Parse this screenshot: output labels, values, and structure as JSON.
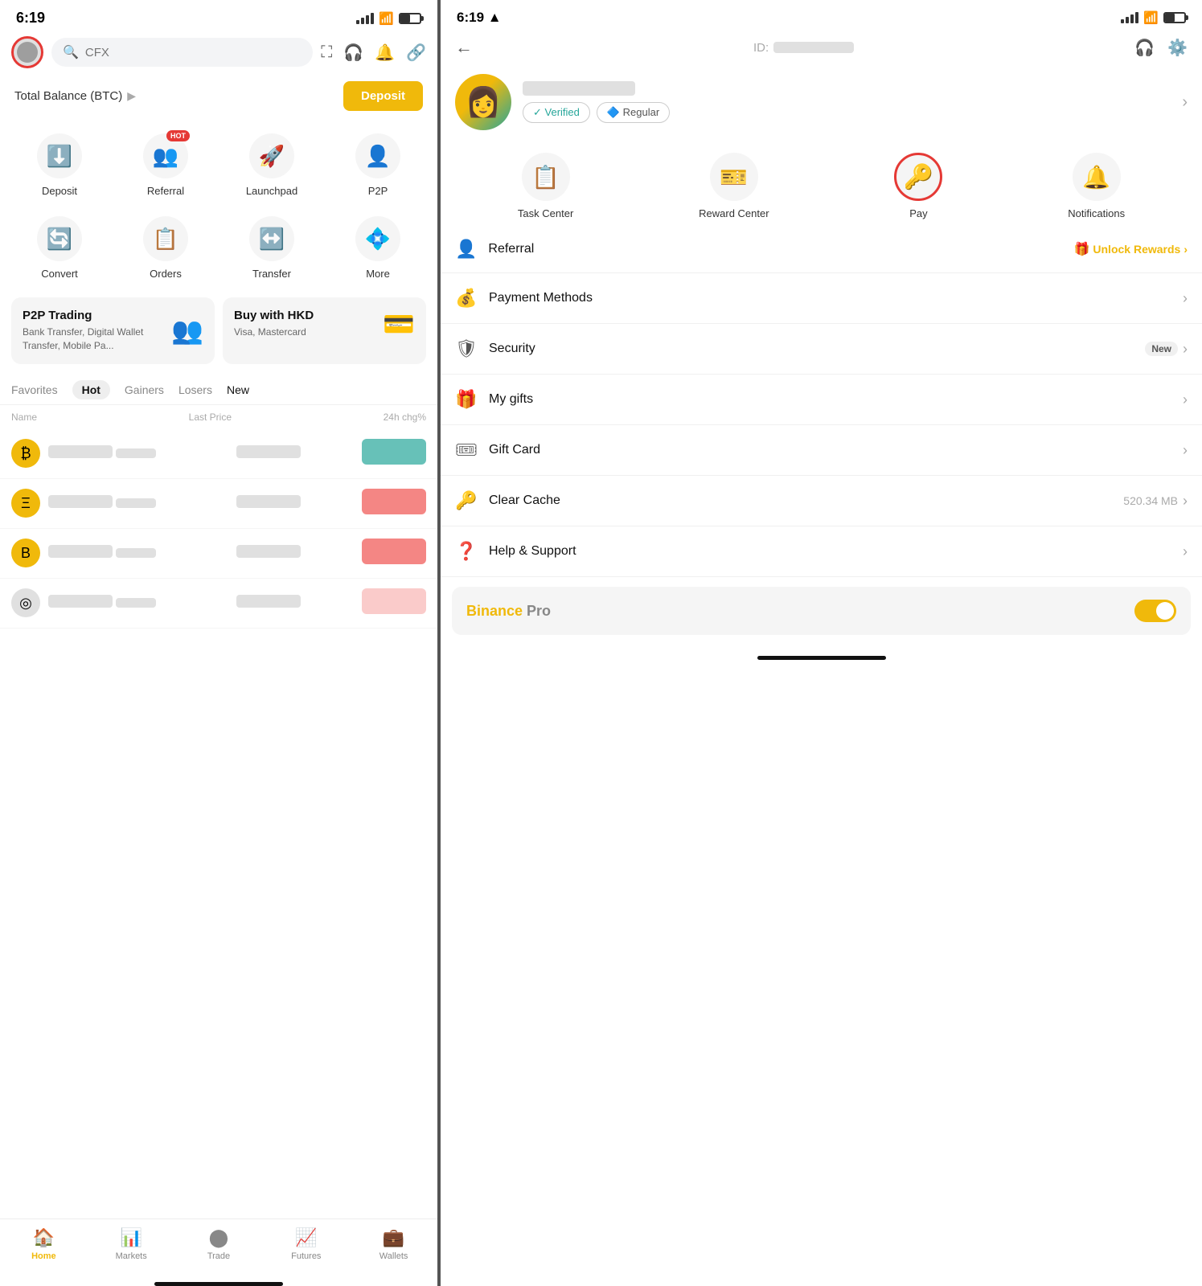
{
  "left": {
    "status": {
      "time": "6:19",
      "battery_level": 50
    },
    "search": {
      "placeholder": "CFX"
    },
    "balance": {
      "label": "Total Balance (BTC)",
      "deposit_btn": "Deposit"
    },
    "actions": [
      {
        "id": "deposit",
        "label": "Deposit",
        "icon": "⬇️",
        "hot": false
      },
      {
        "id": "referral",
        "label": "Referral",
        "icon": "👥",
        "hot": true
      },
      {
        "id": "launchpad",
        "label": "Launchpad",
        "icon": "🚀",
        "hot": false
      },
      {
        "id": "p2p",
        "label": "P2P",
        "icon": "👤",
        "hot": false
      },
      {
        "id": "convert",
        "label": "Convert",
        "icon": "🔄",
        "hot": false
      },
      {
        "id": "orders",
        "label": "Orders",
        "icon": "📋",
        "hot": false
      },
      {
        "id": "transfer",
        "label": "Transfer",
        "icon": "↔️",
        "hot": false
      },
      {
        "id": "more",
        "label": "More",
        "icon": "💠",
        "hot": false
      }
    ],
    "promo": [
      {
        "title": "P2P Trading",
        "sub": "Bank Transfer, Digital Wallet Transfer, Mobile Pa...",
        "icon": "👥"
      },
      {
        "title": "Buy with HKD",
        "sub": "Visa, Mastercard",
        "icon": "💳"
      }
    ],
    "market_tabs": [
      {
        "label": "Favorites",
        "active": false
      },
      {
        "label": "Hot",
        "active": true
      },
      {
        "label": "Gainers",
        "active": false
      },
      {
        "label": "Losers",
        "active": false
      },
      {
        "label": "New",
        "active": false
      }
    ],
    "market_header": {
      "name": "Name",
      "last_price": "Last Price",
      "change": "24h chg%"
    },
    "market_rows": [
      {
        "coin": "BTC",
        "color": "gold",
        "change": "green"
      },
      {
        "coin": "ETH",
        "color": "gold",
        "change": "red"
      },
      {
        "coin": "BNB",
        "color": "gold",
        "change": "red"
      },
      {
        "coin": "SOL",
        "color": "gray",
        "change": "red"
      }
    ],
    "bottom_nav": [
      {
        "label": "Home",
        "icon": "🏠",
        "active": true
      },
      {
        "label": "Markets",
        "icon": "📊",
        "active": false
      },
      {
        "label": "Trade",
        "icon": "⬤",
        "active": false
      },
      {
        "label": "Futures",
        "icon": "📈",
        "active": false
      },
      {
        "label": "Wallets",
        "icon": "💼",
        "active": false
      }
    ]
  },
  "right": {
    "status": {
      "time": "6:19"
    },
    "header": {
      "id_label": "ID:",
      "back": "←"
    },
    "profile": {
      "verified_label": "✓ Verified",
      "regular_label": "🔷 Regular",
      "chevron": "›"
    },
    "features": [
      {
        "id": "task-center",
        "label": "Task Center",
        "icon": "📋",
        "highlighted": false
      },
      {
        "id": "reward-center",
        "label": "Reward Center",
        "icon": "🎫",
        "highlighted": false
      },
      {
        "id": "pay",
        "label": "Pay",
        "icon": "🔑",
        "highlighted": true
      },
      {
        "id": "notifications",
        "label": "Notifications",
        "icon": "🔔",
        "highlighted": false
      }
    ],
    "referral": {
      "icon": "👤",
      "label": "Referral",
      "unlock_label": "Unlock Rewards",
      "gift_icon": "🎁"
    },
    "menu_items": [
      {
        "id": "payment-methods",
        "label": "Payment Methods",
        "icon": "💰",
        "extra": "",
        "new_tag": false
      },
      {
        "id": "security",
        "label": "Security",
        "icon": "🛡",
        "extra": "",
        "new_tag": true
      },
      {
        "id": "my-gifts",
        "label": "My gifts",
        "icon": "🎁",
        "extra": "",
        "new_tag": false
      },
      {
        "id": "gift-card",
        "label": "Gift Card",
        "icon": "🎟",
        "extra": "",
        "new_tag": false
      },
      {
        "id": "clear-cache",
        "label": "Clear Cache",
        "icon": "🔑",
        "extra": "520.34 MB",
        "new_tag": false
      },
      {
        "id": "help-support",
        "label": "Help & Support",
        "icon": "❓",
        "extra": "",
        "new_tag": false
      }
    ],
    "binance_pro": {
      "binance": "Binance",
      "pro": " Pro",
      "enabled": true
    }
  }
}
